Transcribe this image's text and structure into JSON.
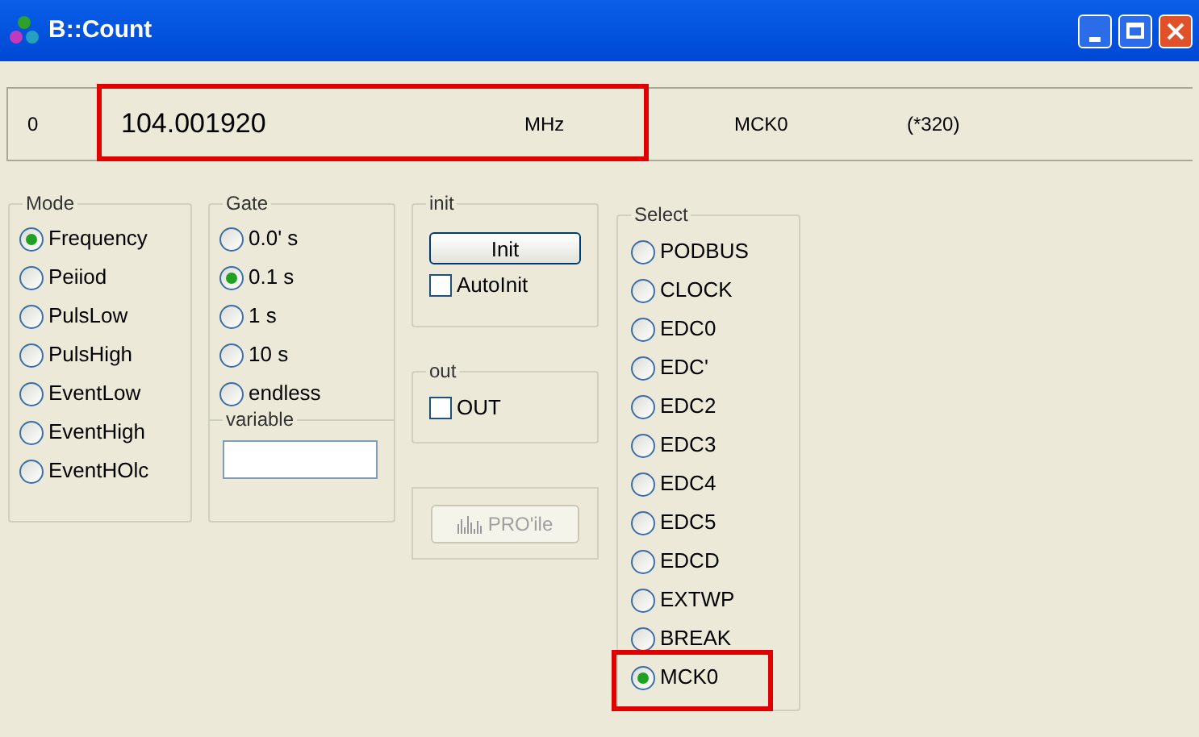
{
  "window": {
    "title": "B::Count"
  },
  "readout": {
    "channel": "0",
    "value": "104.001920",
    "unit": "MHz",
    "source": "MCK0",
    "factor": "(*320)",
    "highlighted": true
  },
  "mode": {
    "label": "Mode",
    "options": [
      {
        "label": "Frequency",
        "selected": true
      },
      {
        "label": "Peiiod",
        "selected": false
      },
      {
        "label": "PulsLow",
        "selected": false
      },
      {
        "label": "PulsHigh",
        "selected": false
      },
      {
        "label": "EventLow",
        "selected": false
      },
      {
        "label": "EventHigh",
        "selected": false
      },
      {
        "label": "EventHOlc",
        "selected": false
      }
    ]
  },
  "gate": {
    "label": "Gate",
    "options": [
      {
        "label": "0.0' s",
        "selected": false
      },
      {
        "label": "0.1 s",
        "selected": true
      },
      {
        "label": "1 s",
        "selected": false
      },
      {
        "label": "10 s",
        "selected": false
      },
      {
        "label": "endless",
        "selected": false
      }
    ],
    "variable": {
      "label": "variable"
    }
  },
  "init": {
    "label": "init",
    "button": "Init",
    "autoinit": {
      "label": "AutoInit",
      "checked": false
    }
  },
  "out": {
    "label": "out",
    "checkbox": {
      "label": "OUT",
      "checked": false
    }
  },
  "profile": {
    "button": "PRO'ile",
    "disabled": true
  },
  "select": {
    "label": "Select",
    "options": [
      {
        "label": "PODBUS",
        "selected": false,
        "highlighted": false
      },
      {
        "label": "CLOCK",
        "selected": false,
        "highlighted": false
      },
      {
        "label": "EDC0",
        "selected": false,
        "highlighted": false
      },
      {
        "label": "EDC'",
        "selected": false,
        "highlighted": false
      },
      {
        "label": "EDC2",
        "selected": false,
        "highlighted": false
      },
      {
        "label": "EDC3",
        "selected": false,
        "highlighted": false
      },
      {
        "label": "EDC4",
        "selected": false,
        "highlighted": false
      },
      {
        "label": "EDC5",
        "selected": false,
        "highlighted": false
      },
      {
        "label": "EDCD",
        "selected": false,
        "highlighted": false
      },
      {
        "label": "EXTWP",
        "selected": false,
        "highlighted": false
      },
      {
        "label": "BREAK",
        "selected": false,
        "highlighted": false
      },
      {
        "label": "MCK0",
        "selected": true,
        "highlighted": true
      }
    ]
  }
}
